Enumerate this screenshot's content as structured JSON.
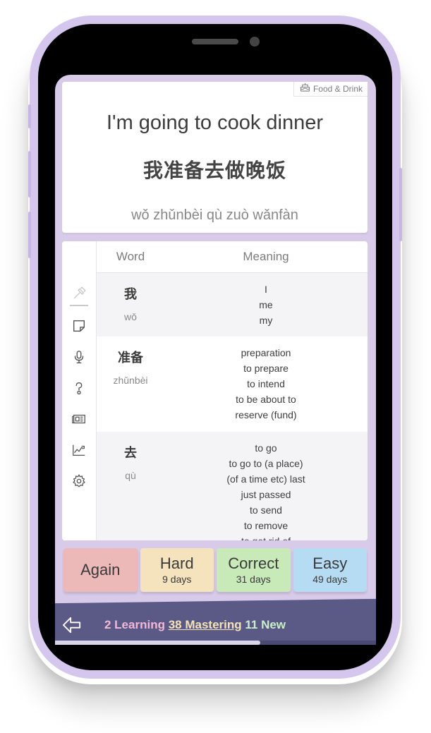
{
  "category": {
    "icon": "cake-icon",
    "label": "Food & Drink"
  },
  "sentence": {
    "english": "I'm going to cook dinner",
    "chinese": "我准备去做晚饭",
    "pinyin": "wǒ zhǔnbèi qù zuò wǎnfàn"
  },
  "tools": [
    {
      "name": "hammer-icon",
      "active": true
    },
    {
      "name": "note-icon",
      "active": false
    },
    {
      "name": "microphone-icon",
      "active": false
    },
    {
      "name": "question-icon",
      "active": false
    },
    {
      "name": "newspaper-icon",
      "active": false
    },
    {
      "name": "chart-icon",
      "active": false
    },
    {
      "name": "gear-icon",
      "active": false
    }
  ],
  "table": {
    "header_word": "Word",
    "header_meaning": "Meaning",
    "rows": [
      {
        "hanzi": "我",
        "pinyin": "wǒ",
        "meanings": [
          "I",
          "me",
          "my"
        ]
      },
      {
        "hanzi": "准备",
        "pinyin": "zhǔnbèi",
        "meanings": [
          "preparation",
          "to prepare",
          "to intend",
          "to be about to",
          "reserve (fund)"
        ]
      },
      {
        "hanzi": "去",
        "pinyin": "qù",
        "meanings": [
          "to go",
          "to go to (a place)",
          "(of a time etc) last",
          "just passed",
          "to send",
          "to remove",
          "to get rid of"
        ]
      }
    ]
  },
  "answers": [
    {
      "label": "Again",
      "sub": "",
      "color": "#edb8b8"
    },
    {
      "label": "Hard",
      "sub": "9 days",
      "color": "#f4e3bd"
    },
    {
      "label": "Correct",
      "sub": "31 days",
      "color": "#c7eab8"
    },
    {
      "label": "Easy",
      "sub": "49 days",
      "color": "#b5dcf2"
    }
  ],
  "stats": {
    "learning": "2 Learning",
    "mastering": "38 Mastering",
    "new": "11 New"
  },
  "progress": 0.64,
  "colors": {
    "phone_frame": "#d4c6ec",
    "screen_bg": "#d8cbea",
    "bottom_bar": "#5b5a87"
  }
}
